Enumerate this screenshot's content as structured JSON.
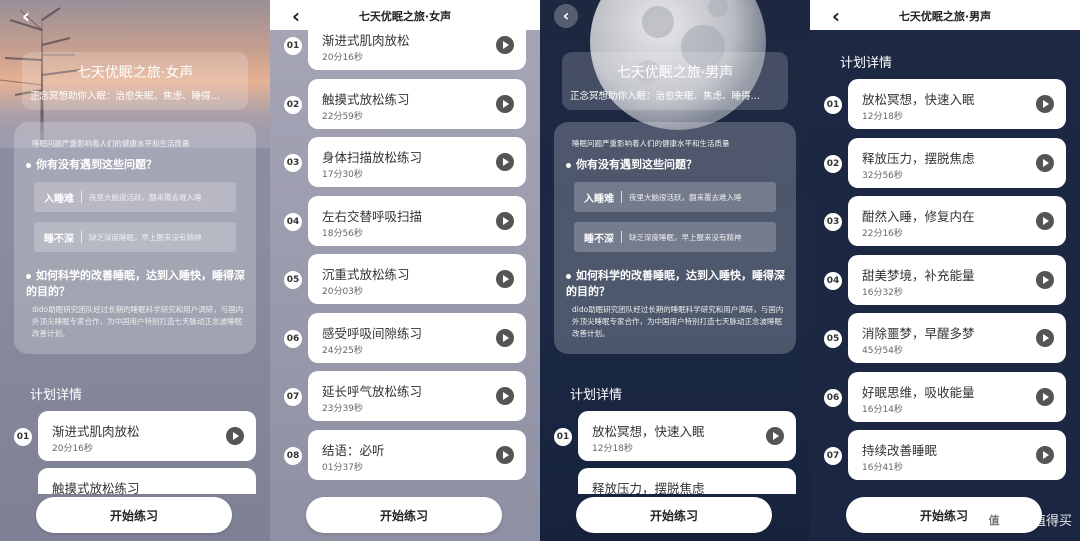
{
  "common": {
    "intro_text": "睡眠问题严重影响着人们的健康水平和生活质量",
    "question1": "你有没有遇到这些问题？",
    "issues": [
      {
        "tag": "入睡难",
        "desc": "夜里大脑很活跃，翻来覆去难入睡"
      },
      {
        "tag": "睡不深",
        "desc": "缺乏深度睡眠，早上醒来没有精神"
      }
    ],
    "question2": "如何科学的改善睡眠，达到入睡快，睡得深的目的？",
    "question2_text": "dido助眠研究团队经过长期的睡眠科学研究和用户调研，与国内外顶尖睡眠专家合作，为中国用户特别打造七天脉动正念波睡眠改善计划。",
    "plan_label": "计划详情",
    "start_button": "开始练习"
  },
  "female": {
    "title": "七天优眠之旅·女声",
    "subtitle": "正念冥想助你入眠：治愈失眠、焦虑、睡得…",
    "tracks": [
      {
        "num": "01",
        "name": "渐进式肌肉放松",
        "dur": "20分16秒"
      },
      {
        "num": "02",
        "name": "触摸式放松练习",
        "dur": "22分59秒"
      },
      {
        "num": "03",
        "name": "身体扫描放松练习",
        "dur": "17分30秒"
      },
      {
        "num": "04",
        "name": "左右交替呼吸扫描",
        "dur": "18分56秒"
      },
      {
        "num": "05",
        "name": "沉重式放松练习",
        "dur": "20分03秒"
      },
      {
        "num": "06",
        "name": "感受呼吸间隙练习",
        "dur": "24分25秒"
      },
      {
        "num": "07",
        "name": "延长呼气放松练习",
        "dur": "23分39秒"
      },
      {
        "num": "08",
        "name": "结语：必听",
        "dur": "01分37秒"
      }
    ]
  },
  "male": {
    "title": "七天优眠之旅·男声",
    "subtitle": "正念冥想助你入眠：治愈失眠、焦虑、睡得…",
    "tracks": [
      {
        "num": "01",
        "name": "放松冥想，快速入眠",
        "dur": "12分18秒"
      },
      {
        "num": "02",
        "name": "释放压力，摆脱焦虑",
        "dur": "32分56秒"
      },
      {
        "num": "03",
        "name": "酣然入睡，修复内在",
        "dur": "22分16秒"
      },
      {
        "num": "04",
        "name": "甜美梦境，补充能量",
        "dur": "16分32秒"
      },
      {
        "num": "05",
        "name": "消除噩梦，早醒多梦",
        "dur": "45分54秒"
      },
      {
        "num": "06",
        "name": "好眠思维，吸收能量",
        "dur": "16分14秒"
      },
      {
        "num": "07",
        "name": "持续改善睡眠",
        "dur": "16分41秒"
      }
    ]
  },
  "watermark": {
    "badge": "值",
    "text": "什么值得买"
  },
  "colors": {
    "female_bg": "#8e8ea2",
    "male_bg": "#1d2740",
    "card": "#ffffff",
    "play": "#555555"
  }
}
